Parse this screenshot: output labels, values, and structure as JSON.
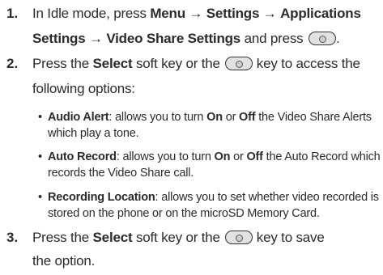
{
  "steps": [
    {
      "number": "1.",
      "parts": [
        "In Idle mode, press ",
        "Menu",
        " → ",
        "Settings",
        " → ",
        "Applications",
        "Settings",
        " → ",
        "Video Share Settings",
        " and press",
        "."
      ]
    },
    {
      "number": "2.",
      "parts": [
        "Press the ",
        "Select",
        " soft key or the",
        "key to access the",
        "following options:"
      ]
    },
    {
      "number": "3.",
      "parts": [
        "Press the ",
        "Select",
        " soft key or the",
        "key to save",
        "the option."
      ]
    }
  ],
  "bullets": [
    {
      "title": "Audio Alert",
      "text1": ": allows you to turn ",
      "on": "On",
      "or": " or ",
      "off": "Off",
      "text2": " the Video Share Alerts",
      "line2": "which play a tone."
    },
    {
      "title": "Auto Record",
      "text1": ": allows you to turn ",
      "on": "On",
      "or": " or ",
      "off": "Off",
      "text2": " the Auto Record which",
      "line2": "records the Video Share call."
    },
    {
      "title": "Recording Location",
      "text1": ": allows you to set whether video recorded is",
      "line2": "stored on the phone or on the microSD Memory Card."
    }
  ],
  "bullet_symbol": "•",
  "icons": {
    "key": "menu-ok-key-icon"
  }
}
